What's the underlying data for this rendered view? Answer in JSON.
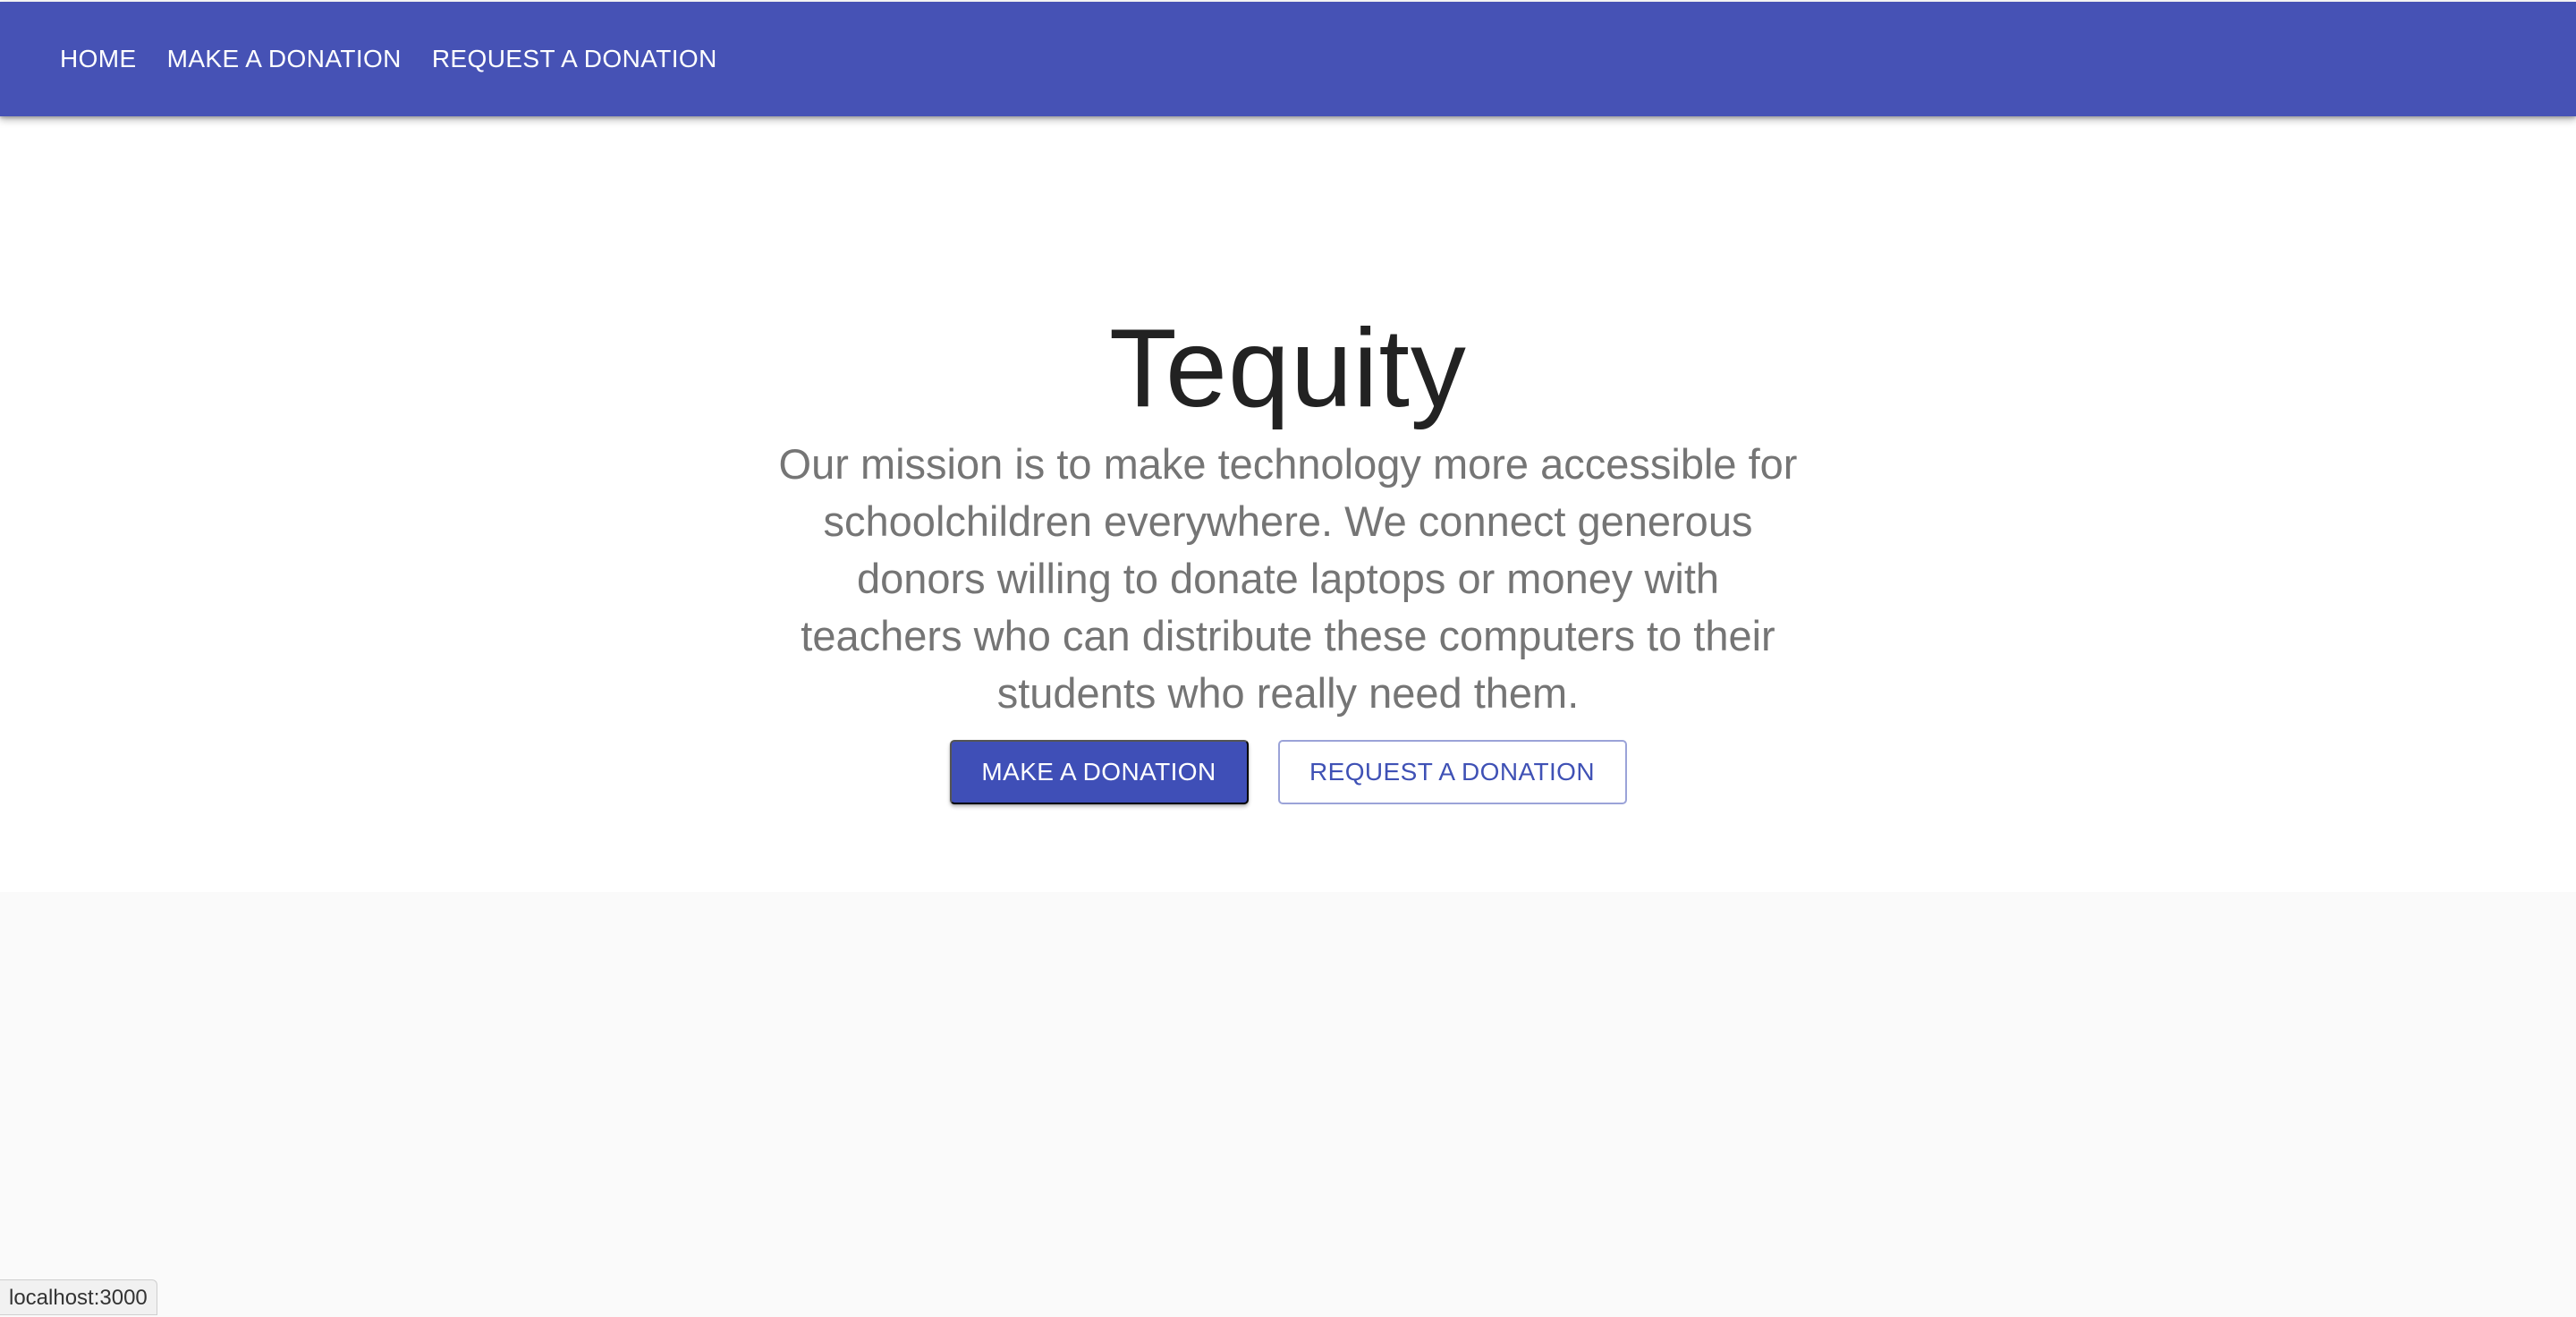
{
  "nav": {
    "items": [
      {
        "label": "HOME"
      },
      {
        "label": "MAKE A DONATION"
      },
      {
        "label": "REQUEST A DONATION"
      }
    ]
  },
  "hero": {
    "title": "Tequity",
    "mission": "Our mission is to make technology more accessible for schoolchildren everywhere. We connect generous donors willing to donate laptops or money with teachers who can distribute these computers to their students who really need them.",
    "primary_button": "MAKE A DONATION",
    "secondary_button": "REQUEST A DONATION"
  },
  "status": {
    "url": "localhost:3000"
  },
  "colors": {
    "app_bar": "#4652b5",
    "primary": "#3f51b5",
    "page_background": "#fafafa",
    "hero_background": "#ffffff"
  }
}
